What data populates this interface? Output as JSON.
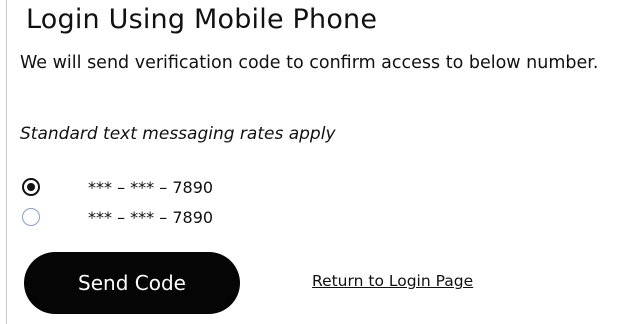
{
  "page": {
    "title": "Login Using Mobile Phone",
    "description": "We will send verification code to confirm access to below number.",
    "rates_note": "Standard text messaging rates apply"
  },
  "phone_options": [
    {
      "label": "*** – *** – 7890",
      "selected": true
    },
    {
      "label": "*** – *** – 7890",
      "selected": false
    }
  ],
  "actions": {
    "send_code_label": "Send Code",
    "return_link_label": "Return to Login Page"
  },
  "colors": {
    "button_bg": "#050505",
    "button_text": "#ffffff",
    "text": "#111111",
    "unchecked_radio_border": "#8aa0c4"
  }
}
